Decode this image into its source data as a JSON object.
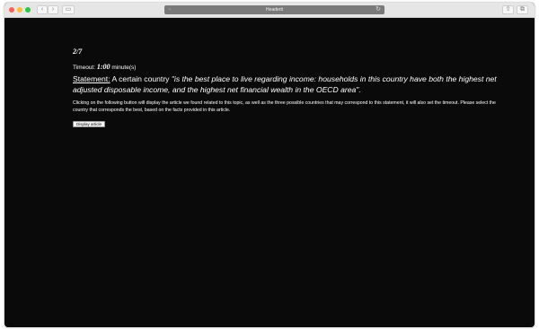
{
  "browser": {
    "address": "Headerit",
    "back_icon": "chevron-left-icon",
    "forward_icon": "chevron-right-icon"
  },
  "quiz": {
    "progress": "2/7",
    "timeout_label": "Timeout:",
    "timeout_value": "1:00",
    "timeout_unit": "minute(s)",
    "statement_label": "Statement:",
    "statement_prefix": " A certain country ",
    "statement_quote": "\"is the best place to live regarding income: households in this country have both the highest net adjusted disposable income, and the highest net financial wealth in the OECD area\".",
    "info": "Clicking on the following button will display the article we found related to this topic, as well as the three possible countries that may correspond to this statement, it will also set the timeout. Please select the country that corresponds the best, based on the facts provided in this article.",
    "button_label": "Display article"
  }
}
